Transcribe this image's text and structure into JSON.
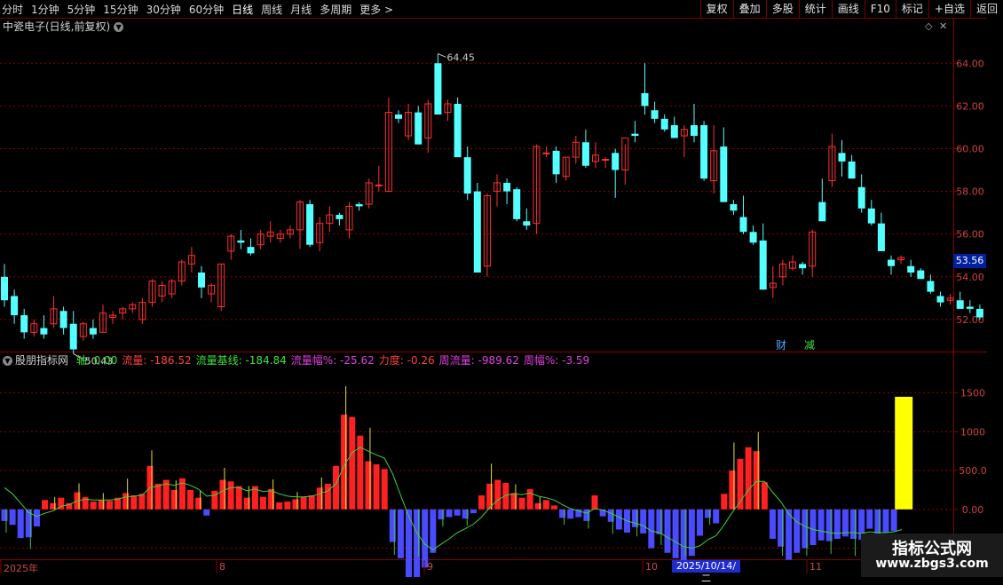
{
  "toolbar": {
    "periods": [
      "分时",
      "1分钟",
      "5分钟",
      "15分钟",
      "30分钟",
      "60分钟",
      "日线",
      "周线",
      "月线",
      "多周期",
      "更多 >"
    ],
    "active_period": "日线",
    "right_buttons": [
      "复权",
      "叠加",
      "多股",
      "统计",
      "画线",
      "F10",
      "标记",
      "+自选",
      "返回"
    ]
  },
  "main": {
    "title": "中瓷电子(日线,前复权)",
    "y_ticks": [
      "64.00",
      "62.00",
      "60.00",
      "58.00",
      "56.00",
      "54.00",
      "52.00"
    ],
    "last_price": "53.56",
    "high_label": "64.45",
    "low_label": "50.43",
    "markers": [
      "财",
      "减"
    ]
  },
  "indicator": {
    "name": "股朋指标网",
    "fields": [
      {
        "label": "轴:",
        "value": "0.00",
        "color": "#40e040"
      },
      {
        "label": "流量:",
        "value": "-186.52",
        "color": "#ff4040"
      },
      {
        "label": "流量基线:",
        "value": "-184.84",
        "color": "#40e040"
      },
      {
        "label": "流量幅%:",
        "value": "-25.62",
        "color": "#e040e0"
      },
      {
        "label": "力度:",
        "value": "-0.26",
        "color": "#ff4040"
      },
      {
        "label": "周流量:",
        "value": "-989.62",
        "color": "#e040e0"
      },
      {
        "label": "周幅%:",
        "value": "-3.59",
        "color": "#e040e0"
      }
    ],
    "y_ticks": [
      "1500",
      "1000",
      "500.0",
      "0.00",
      "-500.0"
    ]
  },
  "xaxis": {
    "labels": [
      "2025年",
      "8",
      "9",
      "10",
      "11"
    ],
    "cursor_date": "2025/10/14/二"
  },
  "watermark": {
    "line1": "指标公式网",
    "line2": "www.zbgs3.com"
  },
  "colors": {
    "up": "#ff3030",
    "down": "#54ffff",
    "grid": "#8a0000",
    "flow_pos": "#ff2020",
    "flow_neg": "#4a4aff",
    "baseline": "#40d040",
    "volume_spike": "#ffff00"
  },
  "chart_data": {
    "type": "candlestick",
    "y_range": [
      50.5,
      65.3
    ],
    "candles": [
      [
        54.0,
        54.6,
        52.6,
        52.9
      ],
      [
        53.1,
        53.4,
        51.8,
        52.2
      ],
      [
        52.2,
        52.5,
        51.1,
        51.4
      ],
      [
        51.4,
        52.0,
        51.2,
        51.8
      ],
      [
        51.6,
        52.2,
        51.1,
        51.3
      ],
      [
        51.8,
        53.1,
        51.6,
        52.5
      ],
      [
        52.4,
        52.6,
        51.3,
        51.6
      ],
      [
        51.8,
        52.4,
        50.4,
        50.6
      ],
      [
        51.2,
        51.9,
        51.0,
        51.8
      ],
      [
        51.6,
        52.0,
        51.1,
        51.3
      ],
      [
        51.4,
        52.7,
        51.4,
        52.3
      ],
      [
        52.1,
        52.4,
        51.8,
        52.2
      ],
      [
        52.3,
        52.6,
        52.0,
        52.5
      ],
      [
        52.5,
        52.8,
        52.3,
        52.7
      ],
      [
        52.0,
        53.0,
        51.8,
        52.8
      ],
      [
        52.8,
        53.9,
        52.6,
        53.8
      ],
      [
        53.1,
        53.8,
        52.8,
        53.6
      ],
      [
        53.2,
        53.9,
        53.0,
        53.8
      ],
      [
        53.8,
        54.8,
        53.6,
        54.7
      ],
      [
        54.6,
        55.4,
        54.2,
        55.0
      ],
      [
        54.2,
        54.5,
        53.0,
        53.5
      ],
      [
        53.2,
        53.7,
        52.8,
        53.6
      ],
      [
        52.6,
        54.6,
        52.4,
        54.6
      ],
      [
        55.2,
        56.0,
        54.8,
        55.9
      ],
      [
        55.7,
        56.2,
        55.3,
        55.6
      ],
      [
        55.4,
        55.8,
        55.0,
        55.1
      ],
      [
        55.5,
        56.2,
        55.3,
        56.0
      ],
      [
        55.9,
        56.6,
        55.6,
        56.1
      ],
      [
        55.8,
        56.2,
        55.6,
        56.0
      ],
      [
        56.0,
        56.4,
        55.8,
        56.2
      ],
      [
        56.2,
        57.6,
        55.3,
        57.5
      ],
      [
        57.4,
        57.6,
        55.4,
        55.5
      ],
      [
        55.6,
        56.8,
        55.2,
        56.5
      ],
      [
        56.5,
        57.3,
        56.1,
        56.9
      ],
      [
        56.9,
        57.0,
        56.4,
        56.7
      ],
      [
        56.2,
        57.5,
        55.8,
        57.3
      ],
      [
        57.4,
        57.5,
        57.1,
        57.3
      ],
      [
        57.4,
        58.6,
        57.2,
        58.4
      ],
      [
        58.3,
        59.2,
        58.0,
        58.3
      ],
      [
        58.0,
        62.4,
        58.0,
        61.7
      ],
      [
        61.6,
        61.8,
        61.2,
        61.4
      ],
      [
        60.6,
        62.1,
        60.4,
        61.7
      ],
      [
        61.7,
        62.0,
        60.2,
        60.2
      ],
      [
        60.5,
        62.3,
        59.8,
        62.1
      ],
      [
        64.0,
        64.45,
        61.6,
        61.6
      ],
      [
        61.7,
        62.3,
        61.3,
        62.1
      ],
      [
        62.1,
        62.4,
        59.6,
        59.6
      ],
      [
        59.6,
        60.1,
        57.6,
        57.9
      ],
      [
        58.0,
        58.4,
        54.2,
        54.2
      ],
      [
        54.5,
        57.9,
        54.0,
        57.8
      ],
      [
        58.0,
        58.8,
        57.3,
        58.4
      ],
      [
        58.4,
        58.6,
        57.4,
        58.0
      ],
      [
        58.1,
        58.2,
        56.6,
        56.7
      ],
      [
        56.6,
        57.2,
        56.2,
        56.4
      ],
      [
        56.5,
        60.2,
        56.0,
        60.1
      ],
      [
        59.8,
        60.1,
        59.6,
        59.8
      ],
      [
        59.9,
        60.1,
        58.4,
        58.8
      ],
      [
        58.7,
        59.6,
        58.5,
        59.6
      ],
      [
        59.6,
        60.6,
        59.3,
        60.3
      ],
      [
        60.3,
        60.9,
        59.1,
        59.2
      ],
      [
        59.4,
        60.3,
        59.1,
        59.7
      ],
      [
        59.5,
        59.6,
        59.1,
        59.5
      ],
      [
        59.8,
        60.0,
        57.7,
        59.0
      ],
      [
        59.0,
        60.2,
        58.3,
        60.5
      ],
      [
        60.7,
        61.3,
        60.3,
        60.6
      ],
      [
        62.6,
        64.0,
        61.6,
        62.0
      ],
      [
        61.8,
        62.2,
        61.2,
        61.4
      ],
      [
        61.4,
        61.6,
        60.8,
        60.9
      ],
      [
        61.1,
        61.5,
        60.6,
        60.5
      ],
      [
        60.6,
        61.1,
        59.6,
        60.9
      ],
      [
        61.1,
        62.1,
        60.3,
        60.6
      ],
      [
        61.1,
        61.3,
        58.5,
        58.6
      ],
      [
        58.5,
        61.1,
        57.9,
        59.9
      ],
      [
        60.1,
        61.0,
        57.5,
        57.5
      ],
      [
        57.4,
        57.6,
        56.9,
        57.1
      ],
      [
        56.8,
        57.8,
        56.0,
        56.1
      ],
      [
        56.1,
        56.4,
        55.5,
        55.6
      ],
      [
        55.7,
        56.5,
        53.4,
        53.4
      ],
      [
        53.5,
        54.5,
        53.0,
        53.7
      ],
      [
        54.0,
        54.8,
        53.6,
        54.6
      ],
      [
        54.4,
        55.0,
        54.3,
        54.7
      ],
      [
        54.6,
        54.7,
        54.1,
        54.4
      ],
      [
        54.5,
        56.2,
        54.0,
        56.1
      ],
      [
        57.5,
        58.6,
        56.6,
        56.6
      ],
      [
        58.5,
        60.7,
        58.2,
        60.1
      ],
      [
        59.8,
        60.4,
        58.7,
        59.4
      ],
      [
        59.4,
        59.7,
        58.6,
        58.6
      ],
      [
        58.2,
        58.8,
        57.0,
        57.2
      ],
      [
        57.2,
        57.6,
        56.4,
        56.5
      ],
      [
        56.5,
        57.0,
        55.2,
        55.2
      ],
      [
        54.8,
        55.0,
        54.1,
        54.5
      ],
      [
        54.8,
        55.0,
        54.6,
        54.9
      ],
      [
        54.5,
        54.8,
        54.0,
        54.2
      ],
      [
        54.3,
        54.4,
        53.9,
        53.9
      ],
      [
        53.8,
        54.1,
        53.2,
        53.3
      ],
      [
        53.1,
        53.3,
        52.6,
        52.8
      ],
      [
        52.9,
        53.2,
        52.7,
        53.0
      ],
      [
        52.9,
        53.3,
        52.5,
        52.5
      ],
      [
        52.6,
        52.9,
        52.3,
        52.5
      ],
      [
        52.5,
        52.7,
        52.0,
        52.1
      ]
    ],
    "flow_series": {
      "name": "流量",
      "y_range": [
        -620,
        1850
      ],
      "values": [
        -150,
        -200,
        -370,
        -360,
        -220,
        120,
        80,
        150,
        80,
        220,
        160,
        100,
        120,
        110,
        150,
        210,
        180,
        200,
        560,
        330,
        380,
        250,
        400,
        250,
        150,
        -80,
        240,
        380,
        360,
        300,
        150,
        300,
        160,
        260,
        90,
        100,
        130,
        160,
        180,
        280,
        330,
        560,
        1220,
        1190,
        950,
        620,
        580,
        520,
        -420,
        -630,
        -1120,
        -960,
        -750,
        -560,
        -130,
        -100,
        -80,
        -120,
        -50,
        180,
        330,
        380,
        340,
        210,
        150,
        260,
        80,
        120,
        50,
        -110,
        -120,
        -100,
        -150,
        180,
        -90,
        -160,
        -260,
        -300,
        -230,
        -310,
        -500,
        -320,
        -560,
        -630,
        -700,
        -600,
        -340,
        -110,
        -180,
        200,
        500,
        650,
        800,
        750,
        350,
        -380,
        -480,
        -650,
        -560,
        -500,
        -460,
        -400,
        -410,
        -380,
        -350,
        -380,
        -390,
        -250,
        -420,
        -300,
        -280,
        1450
      ],
      "baseline": [
        280,
        200,
        80,
        -40,
        -90,
        -50,
        -20,
        40,
        60,
        110,
        130,
        120,
        120,
        120,
        130,
        160,
        170,
        180,
        280,
        300,
        330,
        310,
        340,
        310,
        260,
        170,
        180,
        240,
        280,
        280,
        240,
        260,
        230,
        240,
        200,
        170,
        160,
        160,
        170,
        200,
        240,
        330,
        560,
        730,
        800,
        750,
        700,
        660,
        460,
        180,
        -90,
        -300,
        -450,
        -520,
        -450,
        -380,
        -300,
        -250,
        -190,
        -100,
        20,
        120,
        180,
        200,
        190,
        210,
        170,
        150,
        120,
        60,
        10,
        -20,
        -50,
        10,
        -10,
        -50,
        -100,
        -150,
        -180,
        -210,
        -280,
        -300,
        -360,
        -420,
        -480,
        -500,
        -470,
        -390,
        -340,
        -200,
        -40,
        100,
        250,
        360,
        360,
        220,
        100,
        -60,
        -160,
        -220,
        -260,
        -280,
        -300,
        -310,
        -300,
        -300,
        -310,
        -290,
        -300,
        -300,
        -290,
        -260
      ]
    }
  }
}
